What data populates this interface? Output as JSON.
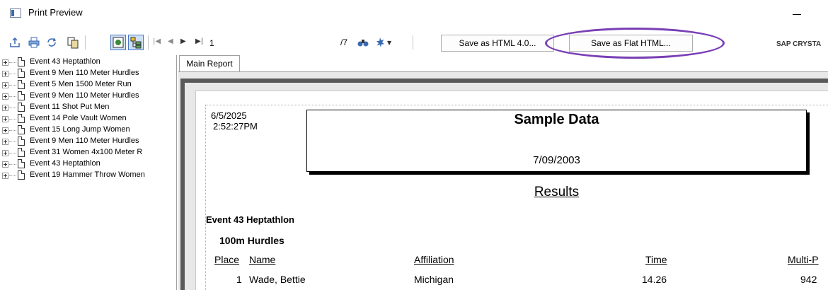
{
  "window": {
    "title": "Print Preview"
  },
  "toolbar": {
    "page_current": "1",
    "page_total": "/7",
    "save_html4_label": "Save as HTML 4.0...",
    "save_flat_html_label": "Save as Flat HTML...",
    "brand": "SAP CRYSTA",
    "highlight_color": "#7a3fb5"
  },
  "tree": {
    "items": [
      {
        "label": "Event  43 Heptathlon"
      },
      {
        "label": "Event   9 Men 110 Meter Hurdles"
      },
      {
        "label": "Event   5 Men 1500 Meter Run"
      },
      {
        "label": "Event   9 Men 110 Meter Hurdles"
      },
      {
        "label": "Event  11 Shot Put Men"
      },
      {
        "label": "Event  14 Pole Vault Women"
      },
      {
        "label": "Event  15 Long Jump Women"
      },
      {
        "label": "Event   9 Men 110 Meter Hurdles"
      },
      {
        "label": "Event  31 Women 4x100 Meter R"
      },
      {
        "label": "Event  43 Heptathlon"
      },
      {
        "label": "Event  19 Hammer Throw Women"
      }
    ]
  },
  "tabs": {
    "main_report": "Main Report"
  },
  "report": {
    "print_date": "6/5/2025",
    "print_time": "2:52:27PM",
    "title": "Sample Data",
    "date": "7/09/2003",
    "subtitle": "Results",
    "event_heading": "Event 43 Heptathlon",
    "sub_event": "100m Hurdles",
    "columns": {
      "place": "Place",
      "name": "Name",
      "affiliation": "Affiliation",
      "time": "Time",
      "multi": "Multi-P"
    },
    "rows": [
      {
        "place": "1",
        "name": "Wade, Bettie",
        "affiliation": "Michigan",
        "time": "14.26",
        "multi": "942"
      }
    ]
  }
}
